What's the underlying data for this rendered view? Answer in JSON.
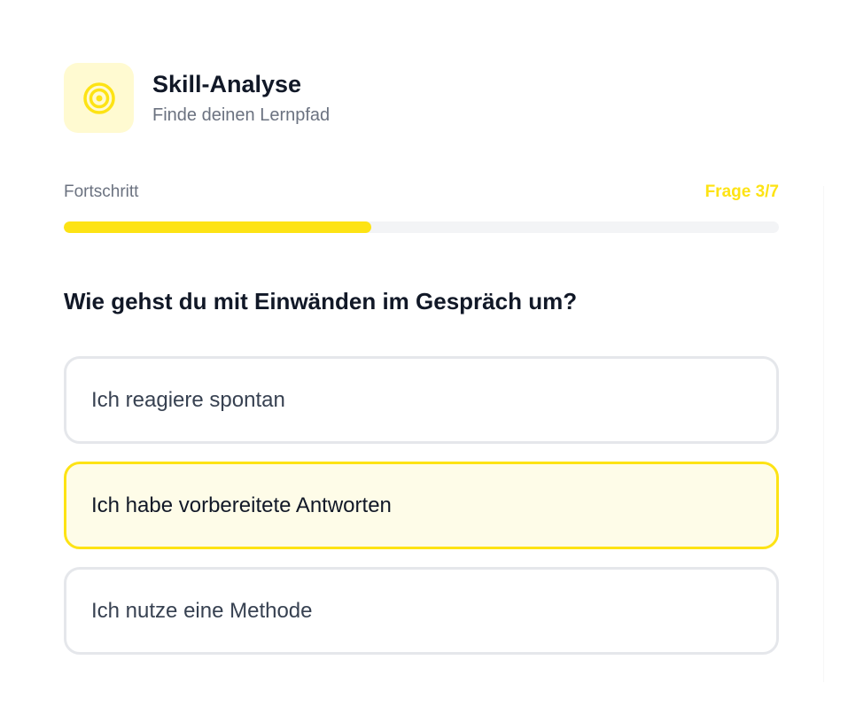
{
  "header": {
    "icon": "target-icon",
    "title": "Skill-Analyse",
    "subtitle": "Finde deinen Lernpfad"
  },
  "progress": {
    "label": "Fortschritt",
    "counter": "Frage 3/7",
    "fraction": 0.43
  },
  "question": {
    "text": "Wie gehst du mit Einwänden im Gespräch um?"
  },
  "options": [
    {
      "label": "Ich reagiere spontan",
      "selected": false
    },
    {
      "label": "Ich habe vorbereitete Antworten",
      "selected": true
    },
    {
      "label": "Ich nutze eine Methode",
      "selected": false
    }
  ],
  "colors": {
    "accent": "#fde314",
    "accent_light": "#fffad1",
    "selected_bg": "#fefce8",
    "text_dark": "#111827",
    "text_muted": "#6b7280",
    "border": "#e5e7eb"
  }
}
